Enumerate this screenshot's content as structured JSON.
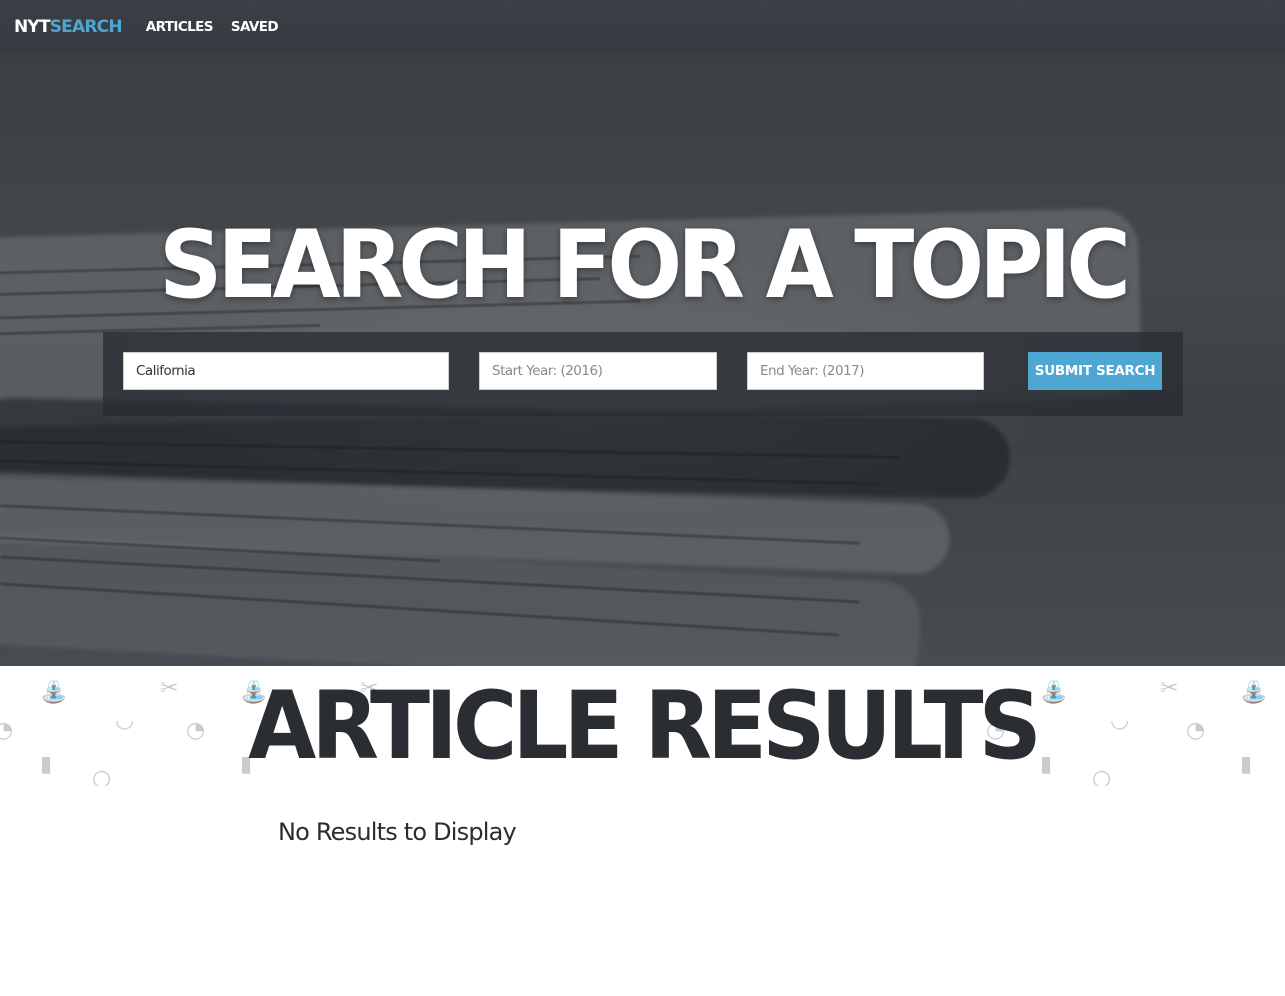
{
  "navbar": {
    "brand_part1": "NYT",
    "brand_part2": "SEARCH",
    "links": [
      "ARTICLES",
      "SAVED"
    ]
  },
  "hero": {
    "title": "SEARCH FOR A TOPIC"
  },
  "search": {
    "topic_value": "California",
    "start_placeholder": "Start Year: (2016)",
    "end_placeholder": "End Year: (2017)",
    "submit_label": "SUBMIT SEARCH"
  },
  "results": {
    "title": "ARTICLE RESULTS",
    "empty_message": "No Results to Display"
  },
  "colors": {
    "accent": "#4ea6d2",
    "navbar": "#3b4046",
    "heading_dark": "#2a2d31"
  }
}
